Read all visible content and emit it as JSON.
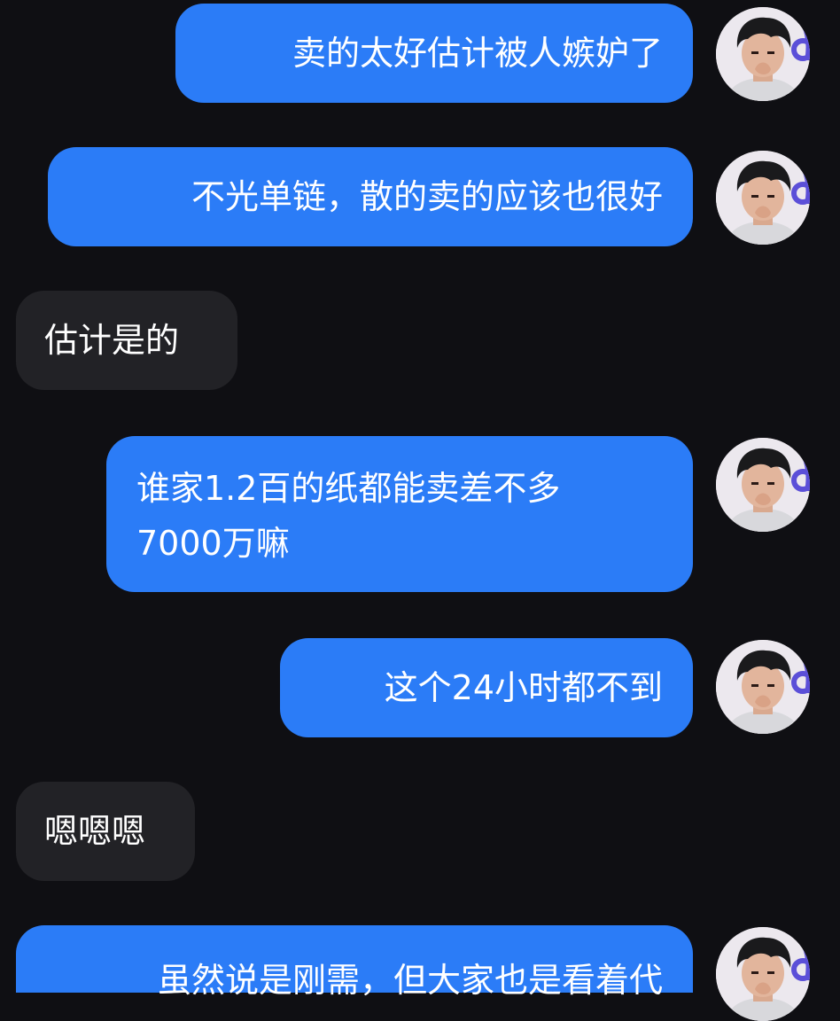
{
  "messages": [
    {
      "id": "m1",
      "side": "out",
      "text": "卖的太好估计被人嫉妒了"
    },
    {
      "id": "m2",
      "side": "out",
      "text": "不光单链，散的卖的应该也很好"
    },
    {
      "id": "m3",
      "side": "in",
      "text": "估计是的"
    },
    {
      "id": "m4",
      "side": "out",
      "lines": [
        "谁家1.2百的纸都能卖差不多",
        "7000万嘛"
      ]
    },
    {
      "id": "m5",
      "side": "out",
      "text": "这个24小时都不到"
    },
    {
      "id": "m6",
      "side": "in",
      "text": "嗯嗯嗯"
    },
    {
      "id": "m7",
      "side": "out",
      "text": "虽然说是刚需，但大家也是看着代"
    }
  ],
  "colors": {
    "background": "#0f0f13",
    "outgoing_bubble": "#2b7cf7",
    "incoming_bubble": "#222226",
    "text": "#ffffff"
  },
  "icons": {
    "avatar": "user-avatar-photo"
  }
}
